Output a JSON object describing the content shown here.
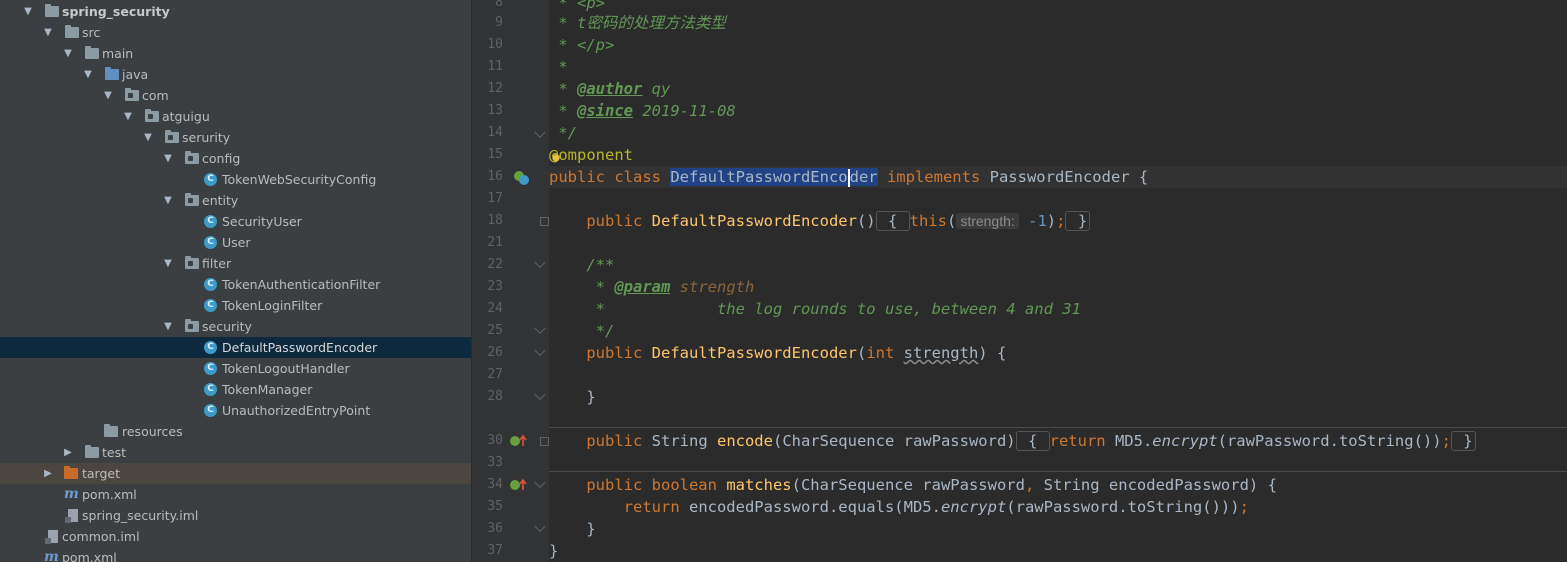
{
  "project_tree": {
    "rows": [
      {
        "label": "spring_security",
        "bold": true
      },
      {
        "label": "src"
      },
      {
        "label": "main"
      },
      {
        "label": "java"
      },
      {
        "label": "com"
      },
      {
        "label": "atguigu"
      },
      {
        "label": "serurity"
      },
      {
        "label": "config"
      },
      {
        "label": "TokenWebSecurityConfig"
      },
      {
        "label": "entity"
      },
      {
        "label": "SecurityUser"
      },
      {
        "label": "User"
      },
      {
        "label": "filter"
      },
      {
        "label": "TokenAuthenticationFilter"
      },
      {
        "label": "TokenLoginFilter"
      },
      {
        "label": "security"
      },
      {
        "label": "DefaultPasswordEncoder"
      },
      {
        "label": "TokenLogoutHandler"
      },
      {
        "label": "TokenManager"
      },
      {
        "label": "UnauthorizedEntryPoint"
      },
      {
        "label": "resources"
      },
      {
        "label": "test"
      },
      {
        "label": "target"
      },
      {
        "label": "pom.xml"
      },
      {
        "label": "spring_security.iml"
      },
      {
        "label": "common.iml"
      },
      {
        "label": "pom.xml"
      }
    ],
    "icons": {
      "class_letter": "C",
      "maven_letter": "m"
    }
  },
  "editor": {
    "line_numbers": [
      "8",
      "9",
      "10",
      "11",
      "12",
      "13",
      "14",
      "15",
      "16",
      "17",
      "18",
      "21",
      "22",
      "23",
      "24",
      "25",
      "26",
      "27",
      "28",
      "30",
      "33",
      "34",
      "35",
      "36",
      "37"
    ],
    "tokens": {
      "l8": " * <p>",
      "l9": " * t密码的处理方法类型",
      "l10": " * </p>",
      "l11": " *",
      "l12_star": " * ",
      "l12_tag": "@author",
      "l12_val": " qy",
      "l13_star": " * ",
      "l13_tag": "@since",
      "l13_val": " 2019-11-08",
      "l14": " */",
      "l15_a": "@",
      "l15_b": "omponent",
      "l16_kw": "public class ",
      "l16_sel": "DefaultPasswordEnco",
      "l16_sel2": "der",
      "l16_kw2": " implements ",
      "l16_rest": "PasswordEncoder {",
      "l18_kw": "    public ",
      "l18_fn": "DefaultPasswordEncoder",
      "l18_p": "()",
      "l18_b1": " { ",
      "l18_this": "this",
      "l18_op": "(",
      "l18_hint": "strength:",
      "l18_num": " -1",
      "l18_close": ")",
      "l18_semi": ";",
      "l18_b2": " }",
      "l22": "    /**",
      "l23_star": "     * ",
      "l23_tag": "@param",
      "l23_param": " strength",
      "l24": "     *            the log rounds to use, between 4 and 31",
      "l25": "     */",
      "l26_kw": "    public ",
      "l26_fn": "DefaultPasswordEncoder",
      "l26_p": "(",
      "l26_kw2": "int ",
      "l26_arg": "strength",
      "l26_end": ") {",
      "l28": "    }",
      "l30_kw": "    public ",
      "l30_type": "String ",
      "l30_fn": "encode",
      "l30_args": "(CharSequence rawPassword)",
      "l30_b1": " { ",
      "l30_ret": "return ",
      "l30_md5": "MD5.",
      "l30_enc": "encrypt",
      "l30_rest": "(rawPassword.toString())",
      "l30_semi": ";",
      "l30_b2": " }",
      "l34_kw": "    public boolean ",
      "l34_fn": "matches",
      "l34_a": "(CharSequence rawPassword",
      "l34_comma": ", ",
      "l34_b": "String encodedPassword) {",
      "l35_kw": "        return ",
      "l35_a": "encodedPassword.equals(MD5.",
      "l35_enc": "encrypt",
      "l35_b": "(rawPassword.toString()))",
      "l35_semi": ";",
      "l36": "    }",
      "l37": "}"
    }
  },
  "colors": {
    "tree_bg": "#3c3f41",
    "editor_bg": "#2b2b2b",
    "selection": "#0d293e",
    "keyword": "#cc7832",
    "function": "#ffc66d",
    "doc_comment": "#629755"
  }
}
